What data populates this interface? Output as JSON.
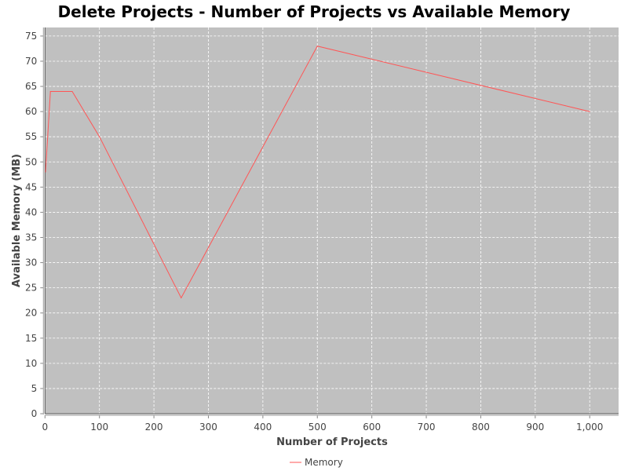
{
  "chart_data": {
    "type": "line",
    "title": "Delete Projects - Number of Projects vs Available Memory",
    "xlabel": "Number of Projects",
    "ylabel": "Available Memory (MB)",
    "xlim": [
      0,
      1053
    ],
    "ylim": [
      0,
      76.7
    ],
    "xticks": [
      0,
      100,
      200,
      300,
      400,
      500,
      600,
      700,
      800,
      900,
      1000
    ],
    "xtick_labels": [
      "0",
      "100",
      "200",
      "300",
      "400",
      "500",
      "600",
      "700",
      "800",
      "900",
      "1,000"
    ],
    "yticks": [
      0,
      5,
      10,
      15,
      20,
      25,
      30,
      35,
      40,
      45,
      50,
      55,
      60,
      65,
      70,
      75
    ],
    "grid": true,
    "legend": "bottom-center",
    "series": [
      {
        "name": "Memory",
        "color": "#ff5555",
        "x": [
          1,
          10,
          50,
          100,
          250,
          500,
          1000
        ],
        "y": [
          48,
          64,
          64,
          55,
          23,
          73,
          60
        ]
      }
    ],
    "plot_background": "#c0c0c0"
  }
}
